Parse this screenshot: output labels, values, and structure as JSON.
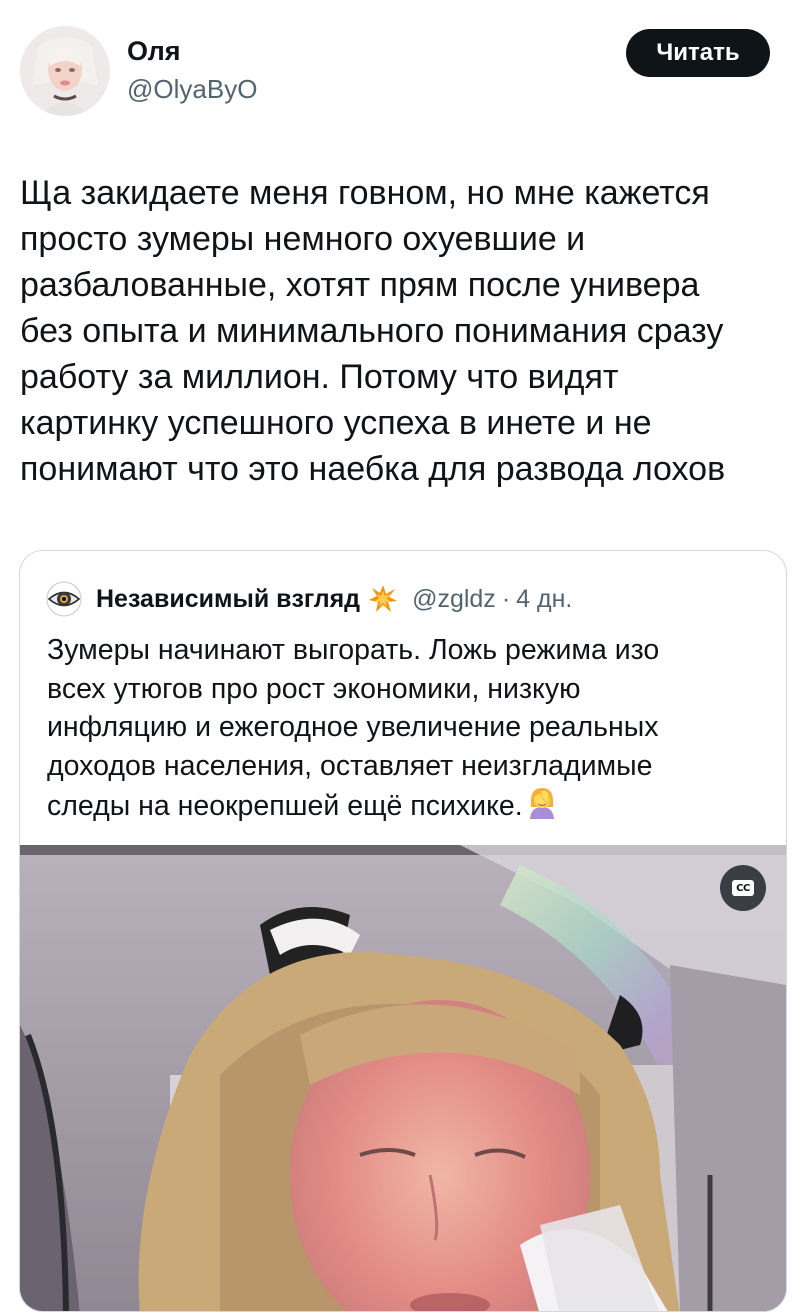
{
  "author": {
    "name": "Оля",
    "handle": "@OlyaByO",
    "avatar_icon": "profile-photo"
  },
  "follow_button": {
    "label": "Читать"
  },
  "tweet": {
    "text": "Ща закидаете меня говном, но мне кажется\nпросто зумеры немного охуевшие и\nразбалованные, хотят прям после универа\nбез опыта и минимального понимания сразу\nработу за миллион. Потому что видят\nкартинку успешного успеха в инете и не\nпонимают что это наебка для развода лохов"
  },
  "quote": {
    "author_name": "Независимый взгляд",
    "author_emoji": "collision-emoji",
    "handle": "@zgldz",
    "separator": "·",
    "time": "4 дн.",
    "text": "Зумеры начинают выгорать. Ложь режима изо\nвсех утюгов про рост экономики, низкую\nинфляцию и ежегодное увеличение реальных\nдоходов населения, оставляет неизгладимые\nследы на неокрепшей ещё психике.",
    "trailing_emoji": "facepalm-emoji",
    "video": {
      "caption_button": "CC"
    }
  },
  "colors": {
    "text_primary": "#0f1419",
    "text_secondary": "#536471",
    "border": "#cfd9de",
    "button_bg": "#0f1419"
  }
}
